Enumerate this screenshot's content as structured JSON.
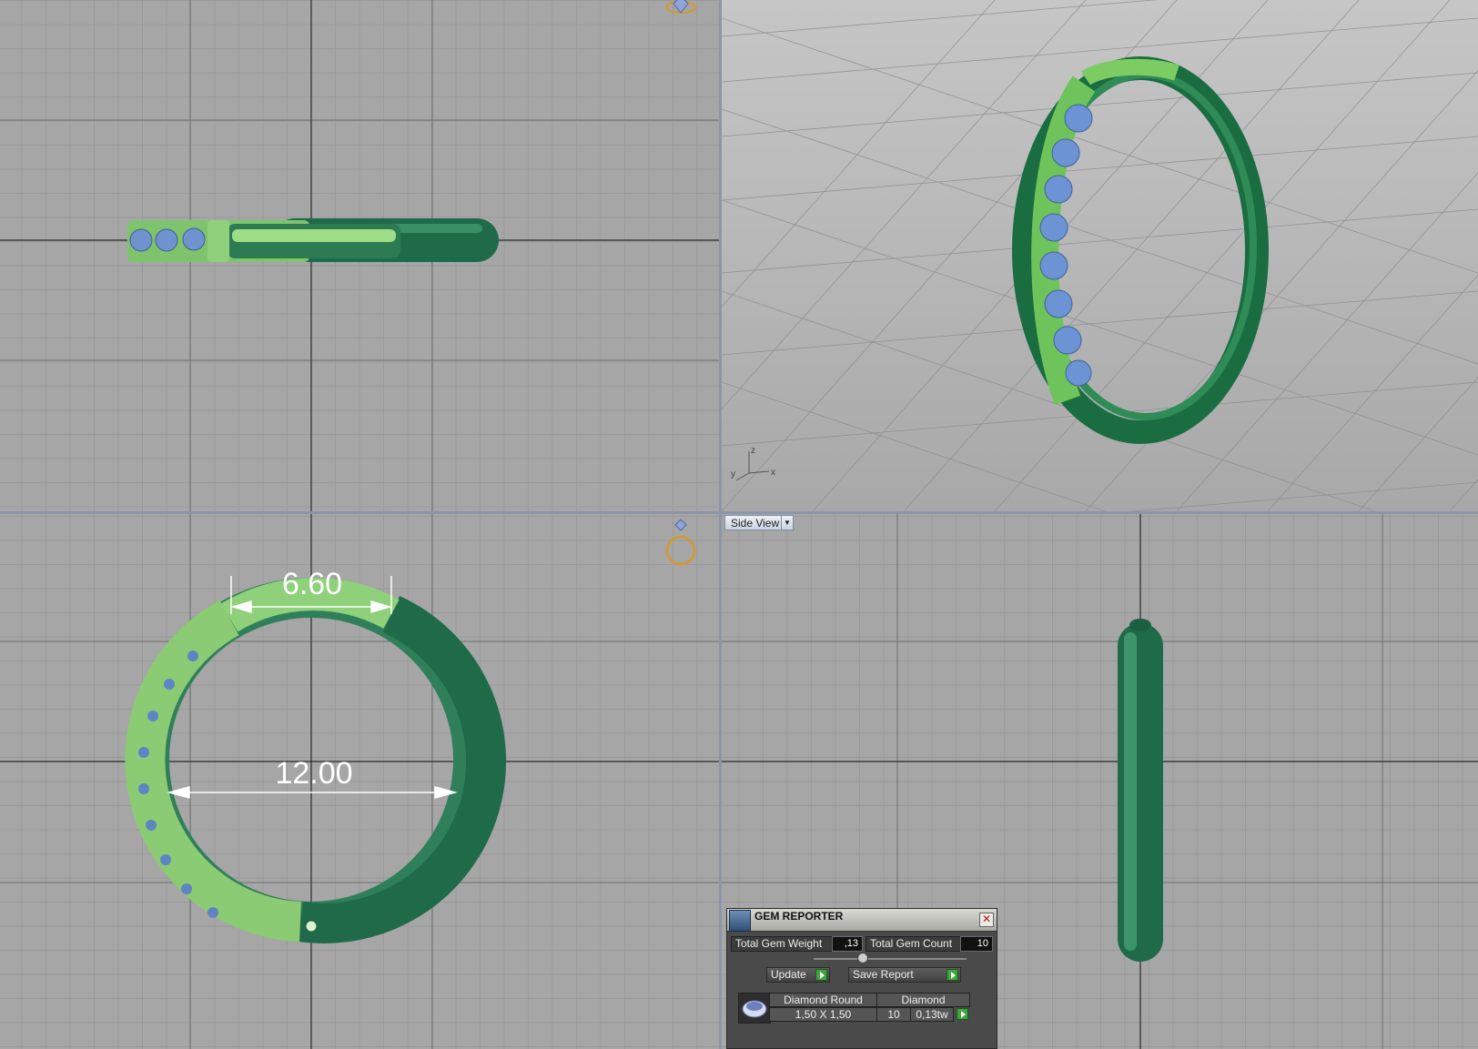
{
  "app": {
    "viewport_label": "Side View",
    "viewport_dropdown_icon": "chevron-down-icon"
  },
  "dimensions": {
    "top_width": "6.60",
    "inner_diameter": "12.00"
  },
  "axis_labels": {
    "z": "z",
    "y": "y",
    "x": "x"
  },
  "gem_reporter": {
    "title": "GEM REPORTER",
    "close_icon": "close-icon",
    "total_gem_weight_label": "Total Gem Weight",
    "total_gem_weight_value": ",13",
    "total_gem_count_label": "Total Gem Count",
    "total_gem_count_value": "10",
    "update_label": "Update",
    "save_report_label": "Save Report",
    "row": {
      "shape": "Diamond Round",
      "material": "Diamond",
      "size": "1,50 X 1,50",
      "count": "10",
      "weight": "0,13tw"
    }
  },
  "colors": {
    "viewport_bg": "#a6a6a6",
    "ring_dark_green": "#1e6e4a",
    "ring_light_green": "#8fd07a",
    "gem_blue": "#7f9fd8",
    "dimension_white": "#ffffff"
  }
}
